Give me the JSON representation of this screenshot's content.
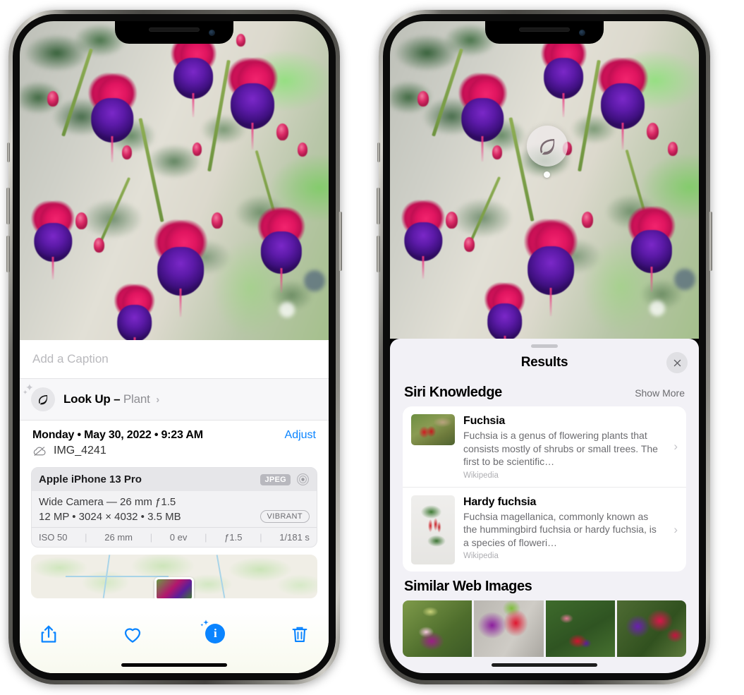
{
  "left_phone": {
    "caption": {
      "placeholder": "Add a Caption",
      "value": ""
    },
    "lookup": {
      "label": "Look Up",
      "dash": "–",
      "subject": "Plant",
      "chevron": "›",
      "icon": "leaf-icon"
    },
    "meta": {
      "date": "Monday • May 30, 2022 • 9:23 AM",
      "adjust_label": "Adjust",
      "filename": "IMG_4241",
      "cloud_icon": "icloud-slash-icon"
    },
    "camera_card": {
      "model": "Apple iPhone 13 Pro",
      "format_badge": "JPEG",
      "aperture_icon": "aperture-icon",
      "lens_line": "Wide Camera — 26 mm ƒ1.5",
      "size_line": "12 MP • 3024 × 4032 • 3.5 MB",
      "style_badge": "VIBRANT",
      "exif": [
        "ISO 50",
        "26 mm",
        "0 ev",
        "ƒ1.5",
        "1/181 s"
      ]
    },
    "toolbar": [
      {
        "name": "share-button",
        "icon": "share-icon"
      },
      {
        "name": "favorite-button",
        "icon": "heart-icon"
      },
      {
        "name": "info-button",
        "icon": "info-sparkle-icon"
      },
      {
        "name": "delete-button",
        "icon": "trash-icon"
      }
    ]
  },
  "right_phone": {
    "visual_lookup_badge": {
      "icon": "leaf-icon"
    },
    "sheet": {
      "title": "Results",
      "close_icon": "close-icon",
      "sections": [
        {
          "title": "Siri Knowledge",
          "action": "Show More",
          "items": [
            {
              "title": "Fuchsia",
              "description": "Fuchsia is a genus of flowering plants that consists mostly of shrubs or small trees. The first to be scientific…",
              "source": "Wikipedia",
              "chevron": "›"
            },
            {
              "title": "Hardy fuchsia",
              "description": "Fuchsia magellanica, commonly known as the hummingbird fuchsia or hardy fuchsia, is a species of floweri…",
              "source": "Wikipedia",
              "chevron": "›"
            }
          ]
        },
        {
          "title": "Similar Web Images",
          "images": [
            "web-image-1",
            "web-image-2",
            "web-image-3",
            "web-image-4"
          ]
        }
      ]
    }
  },
  "colors": {
    "accent_blue": "#0a84ff",
    "sheet_bg": "#f2f1f6",
    "card_bg": "#ffffff",
    "secondary_text": "#6c6c70",
    "tertiary_text": "#aeaeb2"
  }
}
